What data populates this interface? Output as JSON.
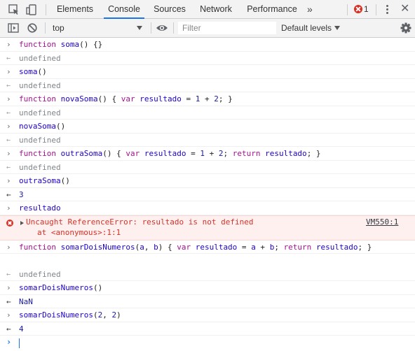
{
  "tabbar": {
    "tabs": [
      {
        "label": "Elements"
      },
      {
        "label": "Console",
        "active": true
      },
      {
        "label": "Sources"
      },
      {
        "label": "Network"
      },
      {
        "label": "Performance"
      }
    ],
    "more_label": "»",
    "error_count": "1",
    "close_label": "✕"
  },
  "toolbar": {
    "context": "top",
    "filter_placeholder": "Filter",
    "levels": "Default levels"
  },
  "console": {
    "rows": [
      {
        "kind": "in",
        "text": "function soma() {}"
      },
      {
        "kind": "out",
        "text": "undefined"
      },
      {
        "kind": "in",
        "text": "soma()"
      },
      {
        "kind": "out",
        "text": "undefined"
      },
      {
        "kind": "in",
        "text": "function novaSoma() { var resultado = 1 + 2; }"
      },
      {
        "kind": "out",
        "text": "undefined"
      },
      {
        "kind": "in",
        "text": "novaSoma()"
      },
      {
        "kind": "out",
        "text": "undefined"
      },
      {
        "kind": "in",
        "text": "function outraSoma() { var resultado = 1 + 2; return resultado; }"
      },
      {
        "kind": "out",
        "text": "undefined"
      },
      {
        "kind": "in",
        "text": "outraSoma()"
      },
      {
        "kind": "num",
        "text": "3"
      },
      {
        "kind": "in",
        "text": "resultado"
      }
    ],
    "error": {
      "message": "Uncaught ReferenceError: resultado is not defined",
      "stack": "at <anonymous>:1:1",
      "link": "VM550:1"
    },
    "rows_after": [
      {
        "kind": "in",
        "text": "function somarDoisNumeros(a, b) { var resultado = a + b; return resultado; }"
      },
      {
        "kind": "blank",
        "text": ""
      },
      {
        "kind": "out",
        "text": "undefined"
      },
      {
        "kind": "in",
        "text": "somarDoisNumeros()"
      },
      {
        "kind": "num",
        "text": "NaN"
      },
      {
        "kind": "in",
        "text": "somarDoisNumeros(2, 2)"
      },
      {
        "kind": "num",
        "text": "4"
      }
    ],
    "prompt_glyph": "›"
  },
  "colors": {
    "accent": "#1a73e8",
    "error": "#d93025",
    "error_bg": "#fff0f0"
  }
}
